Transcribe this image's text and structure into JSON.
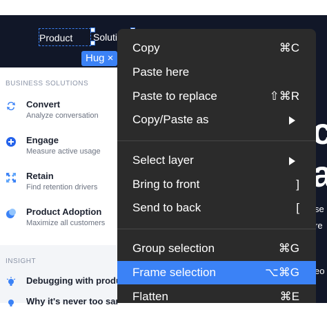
{
  "nav": {
    "product": "Product",
    "solutions": "Soluti",
    "hug_badge": "Hug ×"
  },
  "panel": {
    "business_heading": "BUSINESS SOLUTIONS",
    "items": [
      {
        "title": "Convert",
        "subtitle": "Analyze conversation",
        "icon": "convert-icon",
        "color": "#3b82f6"
      },
      {
        "title": "Engage",
        "subtitle": "Measure active usage",
        "icon": "plus-circle-icon",
        "color": "#2563eb"
      },
      {
        "title": "Retain",
        "subtitle": "Find retention drivers",
        "icon": "expand-arrows-icon",
        "color": "#3b82f6"
      },
      {
        "title": "Product Adoption",
        "subtitle": "Maximize all customers",
        "icon": "adoption-icon",
        "color": "#3b82f6"
      }
    ],
    "insight_heading": "INSIGHT",
    "insights": [
      {
        "title": "Debugging with produ",
        "icon": "bulb-icon"
      },
      {
        "title": "Why it's never too sar",
        "icon": "bulb-icon"
      }
    ]
  },
  "page_edge": {
    "letter_c": "c",
    "letter_a": "a",
    "frag_se": "se",
    "frag_re": "re",
    "frag_eo": "eo"
  },
  "context_menu": {
    "items": [
      {
        "label": "Copy",
        "shortcut": "⌘C"
      },
      {
        "label": "Paste here",
        "shortcut": ""
      },
      {
        "label": "Paste to replace",
        "shortcut": "⇧⌘R"
      },
      {
        "label": "Copy/Paste as",
        "shortcut": "",
        "submenu": true
      },
      {
        "label": "Select layer",
        "shortcut": "",
        "submenu": true
      },
      {
        "label": "Bring to front",
        "shortcut": "]"
      },
      {
        "label": "Send to back",
        "shortcut": "["
      },
      {
        "label": "Group selection",
        "shortcut": "⌘G"
      },
      {
        "label": "Frame selection",
        "shortcut": "⌥⌘G"
      },
      {
        "label": "Flatten",
        "shortcut": "⌘E"
      }
    ]
  }
}
